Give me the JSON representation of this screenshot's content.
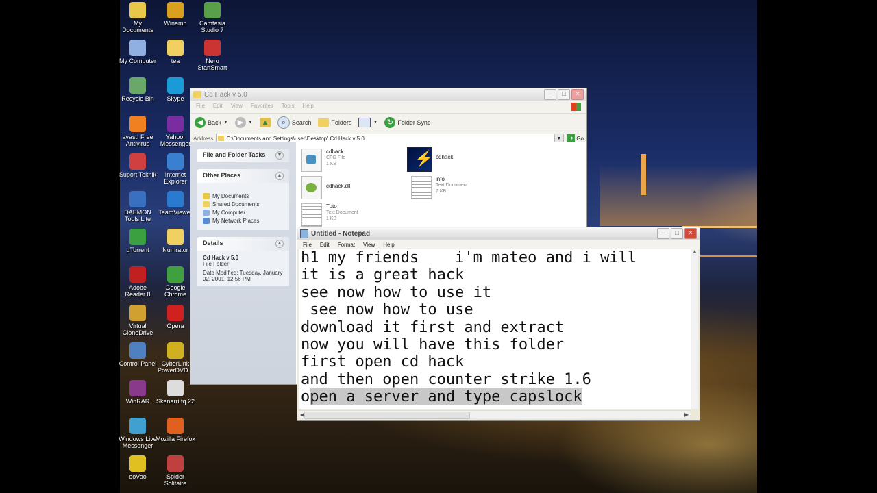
{
  "desktop_icons": [
    {
      "label": "My Documents",
      "icon": "folder-docs-icon",
      "color": "#e8c84a"
    },
    {
      "label": "Winamp",
      "icon": "winamp-icon",
      "color": "#d9a020"
    },
    {
      "label": "Camtasia Studio 7",
      "icon": "camtasia-icon",
      "color": "#5aa04a"
    },
    {
      "label": "My Computer",
      "icon": "computer-icon",
      "color": "#8fb0e0"
    },
    {
      "label": "tea",
      "icon": "folder-icon",
      "color": "#f0d060"
    },
    {
      "label": "Nero StartSmart",
      "icon": "nero-icon",
      "color": "#cc3333"
    },
    {
      "label": "Recycle Bin",
      "icon": "recycle-bin-icon",
      "color": "#6aa86a"
    },
    {
      "label": "Skype",
      "icon": "skype-icon",
      "color": "#1a9ad6"
    },
    {
      "label": "avast! Free Antivirus",
      "icon": "avast-icon",
      "color": "#f08020"
    },
    {
      "label": "Yahoo! Messenger",
      "icon": "yahoo-icon",
      "color": "#7a2da0"
    },
    {
      "label": "Suport Teknik",
      "icon": "support-icon",
      "color": "#d04040"
    },
    {
      "label": "Internet Explorer",
      "icon": "ie-icon",
      "color": "#3a80d0"
    },
    {
      "label": "DAEMON Tools Lite",
      "icon": "daemon-icon",
      "color": "#3a70c0"
    },
    {
      "label": "TeamViewer",
      "icon": "teamviewer-icon",
      "color": "#2a7ad0"
    },
    {
      "label": "µTorrent",
      "icon": "utorrent-icon",
      "color": "#3aa040"
    },
    {
      "label": "Numrator",
      "icon": "folder-icon",
      "color": "#f0d060"
    },
    {
      "label": "Adobe Reader 8",
      "icon": "adobe-reader-icon",
      "color": "#c02020"
    },
    {
      "label": "Google Chrome",
      "icon": "chrome-icon",
      "color": "#40a040"
    },
    {
      "label": "Virtual CloneDrive",
      "icon": "clonedrive-icon",
      "color": "#d0a030"
    },
    {
      "label": "Opera",
      "icon": "opera-icon",
      "color": "#d02020"
    },
    {
      "label": "Control Panel",
      "icon": "control-panel-icon",
      "color": "#5080c0"
    },
    {
      "label": "CyberLink PowerDVD 8",
      "icon": "powerdvd-icon",
      "color": "#d0b020"
    },
    {
      "label": "WinRAR",
      "icon": "winrar-icon",
      "color": "#8a3a8a"
    },
    {
      "label": "Skenarri fq 22",
      "icon": "document-icon",
      "color": "#dddddd"
    },
    {
      "label": "Windows Live Messenger",
      "icon": "messenger-icon",
      "color": "#40a0d0"
    },
    {
      "label": "Mozilla Firefox",
      "icon": "firefox-icon",
      "color": "#e06020"
    },
    {
      "label": "ooVoo",
      "icon": "oovoo-icon",
      "color": "#e0c020"
    },
    {
      "label": "Spider Solitaire",
      "icon": "solitaire-icon",
      "color": "#c04040"
    }
  ],
  "explorer": {
    "title": "Cd Hack v 5.0",
    "menu": [
      "File",
      "Edit",
      "View",
      "Favorites",
      "Tools",
      "Help"
    ],
    "toolbar": {
      "back": "Back",
      "search": "Search",
      "folders": "Folders",
      "folder_sync": "Folder Sync"
    },
    "address_label": "Address",
    "address_value": "C:\\Documents and Settings\\user\\Desktop\\ Cd Hack v 5.0",
    "go_label": "Go",
    "tasks_header": "File and Folder Tasks",
    "other_places_header": "Other Places",
    "other_places": [
      "My Documents",
      "Shared Documents",
      "My Computer",
      "My Network Places"
    ],
    "details_header": "Details",
    "details_name": "Cd Hack v 5.0",
    "details_type": "File Folder",
    "details_modified": "Date Modified: Tuesday, January 02, 2001, 12:56 PM",
    "files": [
      {
        "name": "cdhack",
        "type": "CFG File",
        "size": "1 KB"
      },
      {
        "name": "cdhack",
        "type": "",
        "size": ""
      },
      {
        "name": "cdhack.dll",
        "type": "",
        "size": ""
      },
      {
        "name": "info",
        "type": "Text Document",
        "size": "7 KB"
      },
      {
        "name": "Tuto",
        "type": "Text Document",
        "size": "1 KB"
      }
    ]
  },
  "notepad": {
    "title": "Untitled - Notepad",
    "menu": [
      "File",
      "Edit",
      "Format",
      "View",
      "Help"
    ],
    "lines": [
      "h1 my friends    i'm mateo and i will",
      "it is a great hack",
      "see now how to use it",
      " see now how to use",
      "download it first and extract",
      "now you will have this folder",
      "first open cd hack",
      "and then open counter strike 1.6"
    ],
    "last_line_first": "o",
    "last_line_selected": "pen a server and type capslock"
  }
}
